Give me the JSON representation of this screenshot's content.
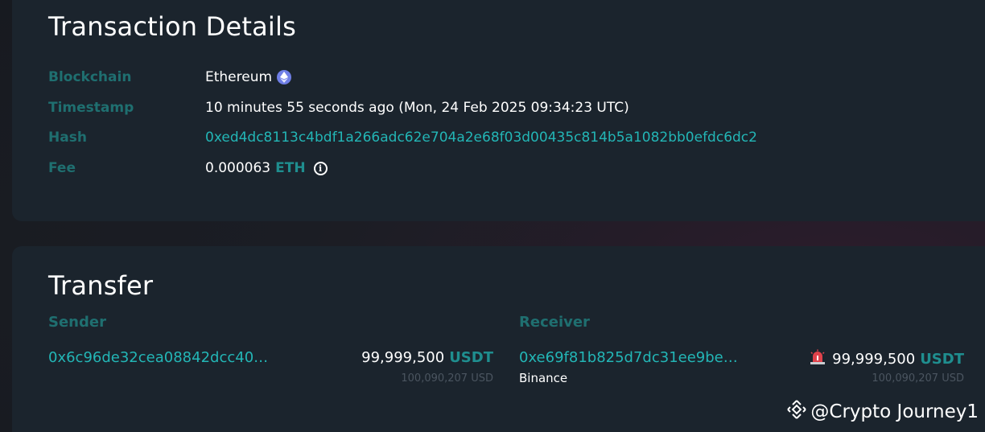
{
  "details": {
    "title": "Transaction Details",
    "blockchain_label": "Blockchain",
    "blockchain_value": "Ethereum",
    "timestamp_label": "Timestamp",
    "timestamp_value": "10 minutes 55 seconds ago (Mon, 24 Feb 2025 09:34:23 UTC)",
    "hash_label": "Hash",
    "hash_value": "0xed4dc8113c4bdf1a266adc62e704a2e68f03d00435c814b5a1082bb0efdc6dc2",
    "fee_label": "Fee",
    "fee_value": "0.000063",
    "fee_currency": "ETH"
  },
  "transfer": {
    "title": "Transfer",
    "sender": {
      "heading": "Sender",
      "address": "0x6c96de32cea08842dcc40…",
      "amount": "99,999,500",
      "currency": "USDT",
      "usd_value": "100,090,207 USD"
    },
    "receiver": {
      "heading": "Receiver",
      "address": "0xe69f81b825d7dc31ee9be…",
      "name": "Binance",
      "amount": "99,999,500",
      "currency": "USDT",
      "usd_value": "100,090,207 USD"
    }
  },
  "watermark": {
    "text": "@Crypto Journey1",
    "icon": "binance-logo-icon"
  },
  "colors": {
    "label_teal": "#1f6f70",
    "link_teal": "#23b6b6",
    "card_bg": "#1b242d",
    "eth_badge": "#6f7fe6",
    "alert_red": "#e0424b"
  }
}
